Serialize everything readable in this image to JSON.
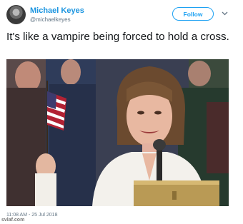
{
  "user": {
    "display_name": "Michael Keyes",
    "handle": "@michaelkeyes"
  },
  "follow_label": "Follow",
  "tweet_text": "It's like a vampire being forced to hold a cross.",
  "timestamp": "11:08 AM - 25 Jul 2018",
  "watermark": "svlaf.com",
  "icons": {
    "menu": "chevron-down-icon"
  },
  "colors": {
    "link_blue": "#1b95e0",
    "follow_blue": "#1da1f2",
    "muted_gray": "#657786"
  }
}
